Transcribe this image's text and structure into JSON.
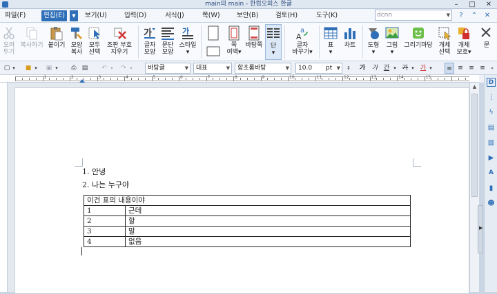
{
  "window": {
    "title": "main의 main - 한컴오피스 한글",
    "controls": {
      "minimize": "–",
      "maximize": "□",
      "close": "✕"
    }
  },
  "menubar": {
    "items": [
      {
        "label": "파일(F)",
        "active": false
      },
      {
        "label": "편집(E)",
        "active": true
      },
      {
        "label": "보기(U)",
        "active": false
      },
      {
        "label": "입력(D)",
        "active": false
      },
      {
        "label": "서식(J)",
        "active": false
      },
      {
        "label": "쪽(W)",
        "active": false
      },
      {
        "label": "보안(B)",
        "active": false
      },
      {
        "label": "검토(H)",
        "active": false
      },
      {
        "label": "도구(K)",
        "active": false
      }
    ],
    "search_value": "dcnn"
  },
  "ribbon": {
    "buttons": [
      {
        "label": "오려\n두기",
        "icon": "scissors-icon",
        "disabled": true
      },
      {
        "label": "복사하기",
        "icon": "copy-icon",
        "disabled": true
      },
      {
        "label": "붙이기",
        "icon": "paste-icon",
        "disabled": false
      },
      {
        "label": "모양\n복사",
        "icon": "format-painter-icon",
        "disabled": false
      },
      {
        "label": "모두\n선택",
        "icon": "select-all-icon",
        "disabled": false
      },
      {
        "label": "조판 부호\n지우기",
        "icon": "clear-codes-icon",
        "disabled": false
      },
      {
        "label": "글자\n모양",
        "icon": "char-shape-icon",
        "disabled": false
      },
      {
        "label": "문단\n모양",
        "icon": "para-shape-icon",
        "disabled": false
      },
      {
        "label": "스타일",
        "icon": "style-icon",
        "disabled": false
      },
      {
        "label": "쪽\n여백",
        "icon": "page-margin-icon",
        "disabled": false
      },
      {
        "label": "바탕쪽",
        "icon": "master-page-icon",
        "disabled": false
      },
      {
        "label": "단",
        "icon": "columns-icon",
        "disabled": false
      },
      {
        "label": "글자\n바꾸기",
        "icon": "replace-char-icon",
        "disabled": false
      },
      {
        "label": "표",
        "icon": "table-icon",
        "disabled": false
      },
      {
        "label": "차트",
        "icon": "chart-icon",
        "disabled": false
      },
      {
        "label": "도형",
        "icon": "shape-icon",
        "disabled": false
      },
      {
        "label": "그림",
        "icon": "picture-icon",
        "disabled": false
      },
      {
        "label": "그리기마당",
        "icon": "clipart-icon",
        "disabled": false
      },
      {
        "label": "개체\n선택",
        "icon": "object-select-icon",
        "disabled": false
      },
      {
        "label": "개체\n보호",
        "icon": "object-protect-icon",
        "disabled": false
      },
      {
        "label": "문",
        "icon": "more-icon",
        "disabled": false
      }
    ]
  },
  "formatbar": {
    "style_value": "바탕글",
    "lang_value": "대표",
    "font_value": "함초롬바탕",
    "size_value": "10.0",
    "size_unit": "pt",
    "bold": "가",
    "italic": "가",
    "underline": "간",
    "strike": "가",
    "color": "가"
  },
  "ruler": {
    "numbers": [
      "1",
      "2",
      "3",
      "4",
      "5",
      "6",
      "7",
      "8",
      "9",
      "10",
      "11",
      "12",
      "13",
      "14",
      "15"
    ]
  },
  "document": {
    "list_items": [
      "1. 안녕",
      "2. 나는 누구야"
    ],
    "table": {
      "header": "이건 표의 내용이야",
      "rows": [
        [
          "1",
          "근데"
        ],
        [
          "2",
          "할"
        ],
        [
          "3",
          "말"
        ],
        [
          "4",
          "없음"
        ]
      ]
    }
  },
  "colors": {
    "accent": "#2f6fb7",
    "ribbon_bg": "#f8fafd",
    "page_bg": "#ffffff"
  }
}
